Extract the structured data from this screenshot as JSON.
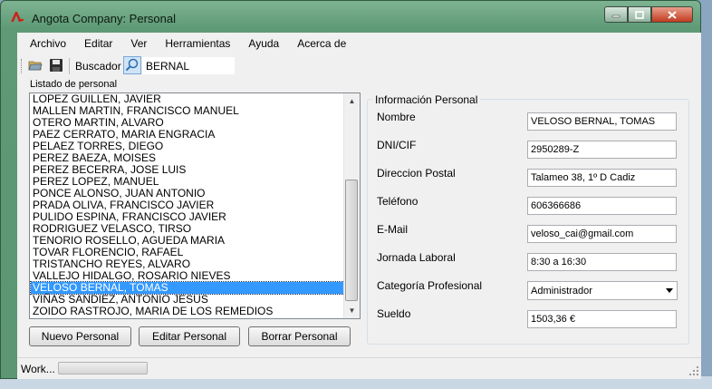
{
  "window": {
    "title": "Angota Company: Personal"
  },
  "menu": [
    "Archivo",
    "Editar",
    "Ver",
    "Herramientas",
    "Ayuda",
    "Acerca de"
  ],
  "toolbar": {
    "search_label": "Buscador",
    "search_value": "BERNAL"
  },
  "list": {
    "title": "Listado de personal",
    "items": [
      "LOPEZ GUILLEN, JAVIER",
      "MALLEN MARTIN, FRANCISCO MANUEL",
      "OTERO MARTIN, ALVARO",
      "PAEZ CERRATO, MARIA ENGRACIA",
      "PELAEZ TORRES, DIEGO",
      "PEREZ BAEZA, MOISES",
      "PEREZ BECERRA, JOSE LUIS",
      "PEREZ LOPEZ, MANUEL",
      "PONCE ALONSO, JUAN ANTONIO",
      "PRADA OLIVA, FRANCISCO JAVIER",
      "PULIDO ESPINA, FRANCISCO JAVIER",
      "RODRIGUEZ VELASCO, TIRSO",
      "TENORIO ROSELLO, AGUEDA MARIA",
      "TOVAR FLORENCIO, RAFAEL",
      "TRISTANCHO REYES, ALVARO",
      "VALLEJO HIDALGO, ROSARIO NIEVES",
      "VELOSO BERNAL, TOMAS",
      "VIÑAS SANDIEZ, ANTONIO JESUS",
      "ZOIDO RASTROJO, MARIA DE LOS REMEDIOS"
    ],
    "selected": "VELOSO BERNAL, TOMAS"
  },
  "buttons": {
    "new": "Nuevo Personal",
    "edit": "Editar Personal",
    "delete": "Borrar Personal"
  },
  "info": {
    "title": "Información  Personal",
    "fields": [
      {
        "label": "Nombre",
        "value": "VELOSO BERNAL, TOMAS"
      },
      {
        "label": "DNI/CIF",
        "value": "2950289-Z"
      },
      {
        "label": "Direccion Postal",
        "value": "Talameo 38, 1º D Cadiz"
      },
      {
        "label": "Teléfono",
        "value": "606366686"
      },
      {
        "label": "E-Mail",
        "value": "veloso_cai@gmail.com"
      },
      {
        "label": "Jornada Laboral",
        "value": "8:30 a 16:30"
      },
      {
        "label": "Categoría Profesional",
        "value": "Administrador"
      },
      {
        "label": "Sueldo",
        "value": "1503,36 €"
      }
    ]
  },
  "status": {
    "text": "Work..."
  },
  "colors": {
    "titlebar": "#5e9a76",
    "selection": "#3399ff",
    "close_button": "#c23a20"
  }
}
